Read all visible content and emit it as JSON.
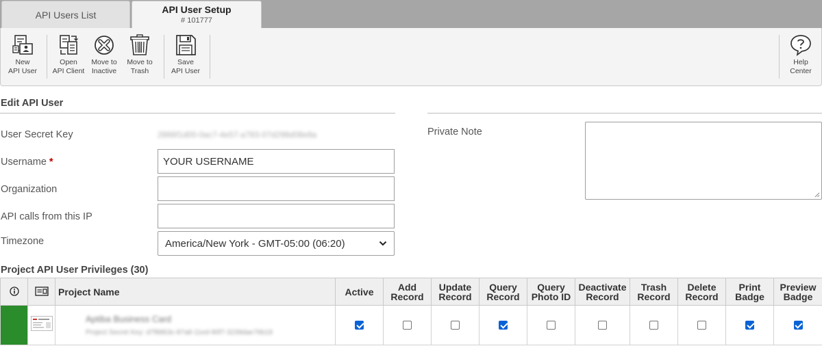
{
  "tabs": [
    {
      "label": "API Users List"
    },
    {
      "label": "API User Setup",
      "sublabel": "# 101777"
    }
  ],
  "toolbar": {
    "new_api_user": "New\nAPI User",
    "open_api_client": "Open\nAPI Client",
    "move_to_inactive": "Move to\nInactive",
    "move_to_trash": "Move to\nTrash",
    "save_api_user": "Save\nAPI User",
    "help_center": "Help\nCenter"
  },
  "edit": {
    "title": "Edit API User",
    "secret_label": "User Secret Key",
    "secret_value": "2866f1d00-0ac7-4e57-a783-07d298d08e8a",
    "username_label": "Username",
    "username_required": "*",
    "username_value": "YOUR USERNAME",
    "organization_label": "Organization",
    "organization_value": "",
    "ip_label": "API calls from this IP",
    "ip_value": "",
    "timezone_label": "Timezone",
    "timezone_value": "America/New York - GMT-05:00 (06:20)",
    "private_note_label": "Private Note",
    "private_note_value": ""
  },
  "privileges": {
    "title": "Project API User Privileges (30)",
    "headers": {
      "info": "ⓘ",
      "project_name": "Project Name",
      "active": "Active",
      "add_record": "Add Record",
      "update_record": "Update Record",
      "query_record": "Query Record",
      "query_photo_id": "Query Photo ID",
      "deactivate_record": "Deactivate Record",
      "trash_record": "Trash Record",
      "delete_record": "Delete Record",
      "print_badge": "Print Badge",
      "preview_badge": "Preview Badge"
    },
    "rows": [
      {
        "status_color": "#2a8c2a",
        "project_name": "Aptiba Business Card",
        "project_secret": "Project Secret Key: d7f8863c-87a8-11ed-90f7-3239dae76b18",
        "active": true,
        "add_record": false,
        "update_record": false,
        "query_record": true,
        "query_photo_id": false,
        "deactivate_record": false,
        "trash_record": false,
        "delete_record": false,
        "print_badge": true,
        "preview_badge": true
      }
    ]
  }
}
